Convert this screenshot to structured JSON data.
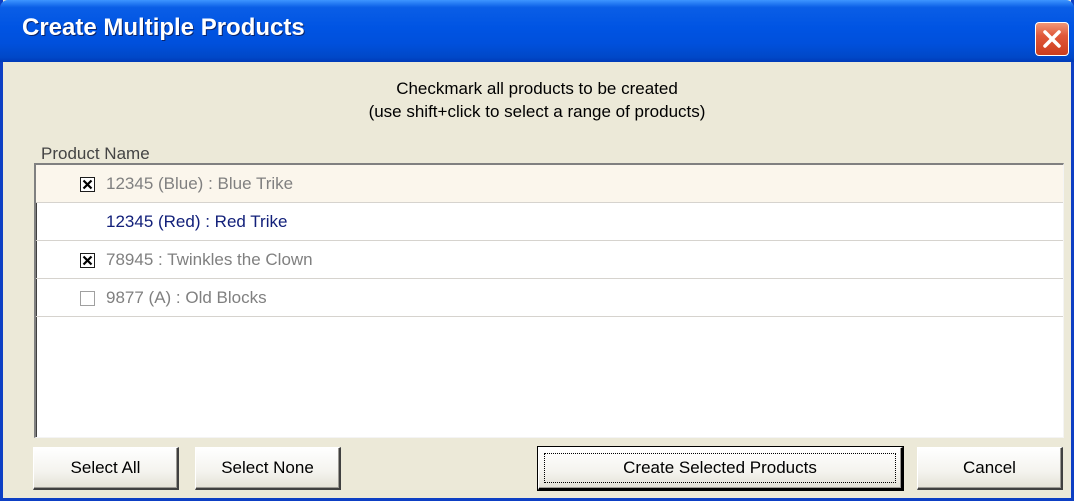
{
  "window": {
    "title": "Create Multiple Products"
  },
  "instructions": {
    "line1": "Checkmark all products to be created",
    "line2": "(use shift+click to select a range of products)"
  },
  "list": {
    "column_header": "Product Name",
    "rows": [
      {
        "label": "12345 (Blue) : Blue Trike",
        "checked": true,
        "has_checkbox": true,
        "selected": true
      },
      {
        "label": "12345 (Red) : Red Trike",
        "checked": false,
        "has_checkbox": false,
        "selected": false
      },
      {
        "label": "78945 : Twinkles the Clown",
        "checked": true,
        "has_checkbox": true,
        "selected": false
      },
      {
        "label": "9877 (A) : Old Blocks",
        "checked": false,
        "has_checkbox": true,
        "selected": false
      }
    ]
  },
  "buttons": {
    "select_all": "Select All",
    "select_none": "Select None",
    "create_selected": "Create Selected Products",
    "cancel": "Cancel"
  },
  "icons": {
    "close": "close-icon",
    "checkmark": "checkbox-x-icon"
  },
  "colors": {
    "titlebar": "#0054e3",
    "dialog_bg": "#ece9d8",
    "close_button": "#e0583a",
    "highlight_text": "#12207a",
    "disabled_text": "#808080"
  }
}
